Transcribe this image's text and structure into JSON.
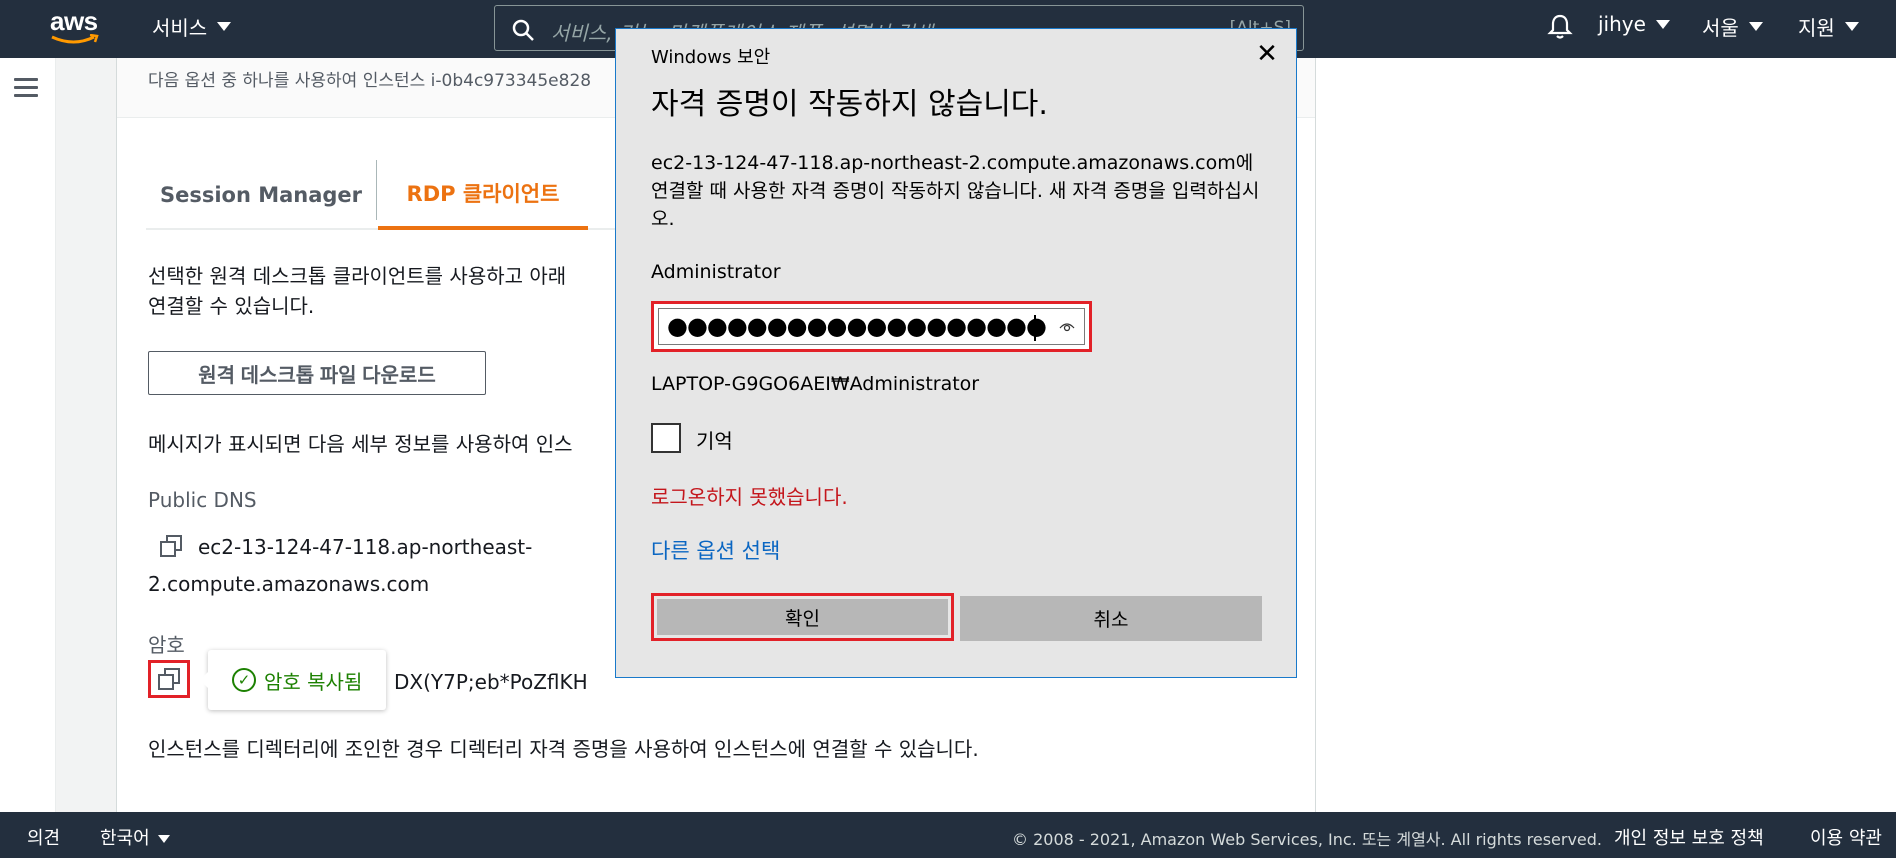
{
  "topnav": {
    "logo": "aws",
    "services_label": "서비스",
    "search_placeholder": "서비스, 기능, 마켓플레이스 제품, 설명서 검색",
    "search_shortcut": "[Alt+S]",
    "user": "jihye",
    "region": "서울",
    "support": "지원",
    "icons": [
      "search-icon",
      "bell-icon",
      "chevron-down-icon"
    ]
  },
  "panel": {
    "header_text": "다음 옵션 중 하나를 사용하여 인스턴스 i-0b4c973345e828",
    "tabs": [
      {
        "label": "Session Manager",
        "active": false
      },
      {
        "label": "RDP 클라이언트",
        "active": true
      }
    ],
    "intro_line1": "선택한 원격 데스크톱 클라이언트를 사용하고 아래",
    "intro_line2": "연결할 수 있습니다.",
    "download_button": "원격 데스크톱 파일 다운로드",
    "prompt_text": "메시지가 표시되면 다음 세부 정보를 사용하여 인스",
    "public_dns_label": "Public DNS",
    "public_dns_line1": "ec2-13-124-47-118.ap-northeast-",
    "public_dns_line2": "2.compute.amazonaws.com",
    "password_label": "암호",
    "password_tail": "DX(Y7P;eb*PoZflKH",
    "copied_toast": "암호 복사됨",
    "directory_note": "인스턴스를 디렉터리에 조인한 경우 디렉터리 자격 증명을 사용하여 인스턴스에 연결할 수 있습니다."
  },
  "dialog": {
    "window_title": "Windows 보안",
    "heading": "자격 증명이 작동하지 않습니다.",
    "message": "ec2-13-124-47-118.ap-northeast-2.compute.amazonaws.com에 연결할 때 사용한 자격 증명이 작동하지 않습니다. 새 자격 증명을 입력하십시오.",
    "username": "Administrator",
    "password_masked": "●●●●●●●●●●●●●●●●●●●",
    "domain_user": "LAPTOP-G9GO6AEI₩Administrator",
    "remember_label": "기억",
    "remember_checked": false,
    "error_text": "로그온하지 못했습니다.",
    "other_options": "다른 옵션 선택",
    "ok_label": "확인",
    "cancel_label": "취소",
    "close_glyph": "✕"
  },
  "footer": {
    "feedback": "의견",
    "language": "한국어",
    "copyright": "© 2008 - 2021, Amazon Web Services, Inc. 또는 계열사. All rights reserved.",
    "privacy": "개인 정보 보호 정책",
    "terms": "이용 약관"
  },
  "colors": {
    "nav_bg": "#232f3e",
    "accent_orange": "#ec7211",
    "highlight_red": "#e22128",
    "success_green": "#1d8102",
    "error_red": "#c4161c",
    "link_blue": "#0a66c2"
  }
}
